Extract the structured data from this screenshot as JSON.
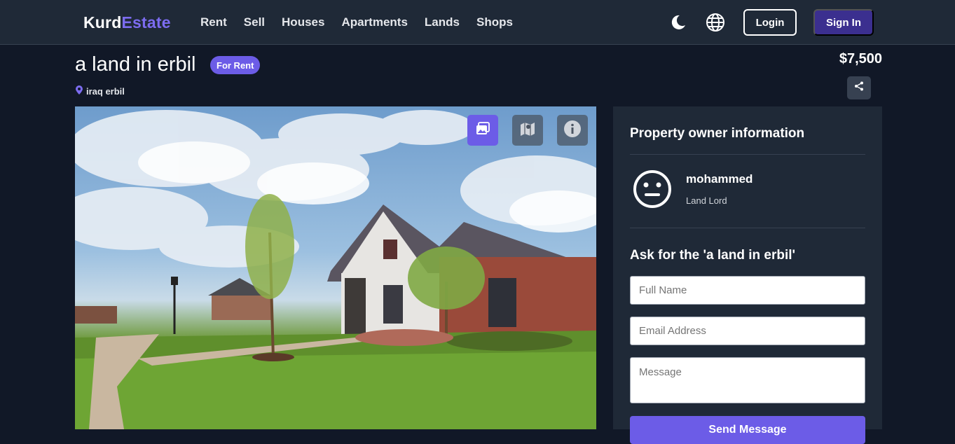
{
  "header": {
    "brand_part1": "Kurd",
    "brand_part2": "Estate",
    "nav": [
      "Rent",
      "Sell",
      "Houses",
      "Apartments",
      "Lands",
      "Shops"
    ],
    "theme_icon": "moon-icon",
    "language_icon": "globe-icon",
    "login_label": "Login",
    "signin_label": "Sign In"
  },
  "listing": {
    "title": "a land in erbil",
    "badge": "For Rent",
    "location": "iraq erbil",
    "price": "$7,500",
    "share_icon": "share-icon"
  },
  "gallery": {
    "tabs": [
      {
        "icon": "image-icon",
        "active": true
      },
      {
        "icon": "map-icon",
        "active": false
      },
      {
        "icon": "info-icon",
        "active": false
      }
    ],
    "photo_alt": "house photo"
  },
  "sidebar": {
    "owner_heading": "Property owner information",
    "owner_name": "mohammed",
    "owner_role": "Land Lord",
    "ask_heading": "Ask for the 'a land in erbil'",
    "full_name_placeholder": "Full Name",
    "email_placeholder": "Email Address",
    "message_placeholder": "Message",
    "send_label": "Send Message"
  },
  "colors": {
    "page_bg": "#111827",
    "panel_bg": "#1f2937",
    "accent": "#6c5ce7",
    "signin_bg": "#3b2f8f"
  }
}
